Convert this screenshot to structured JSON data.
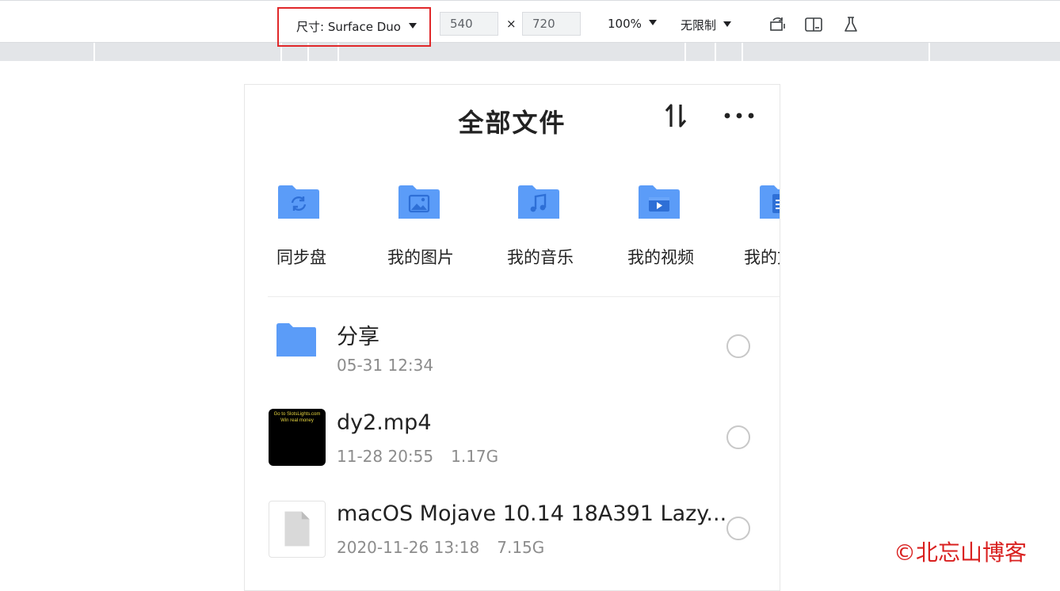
{
  "toolbar": {
    "dimensions_label": "尺寸: Surface Duo",
    "width_value": "540",
    "height_value": "720",
    "times_symbol": "×",
    "zoom_label": "100%",
    "throttle_label": "无限制"
  },
  "app": {
    "title": "全部文件",
    "categories": [
      {
        "label": "同步盘",
        "icon": "sync-folder-icon"
      },
      {
        "label": "我的图片",
        "icon": "image-folder-icon"
      },
      {
        "label": "我的音乐",
        "icon": "music-folder-icon"
      },
      {
        "label": "我的视频",
        "icon": "video-folder-icon"
      },
      {
        "label": "我的文",
        "icon": "document-folder-icon"
      }
    ],
    "files": [
      {
        "name": "分享",
        "date": "05-31 12:34",
        "size": "",
        "icon": "folder-icon"
      },
      {
        "name": "dy2.mp4",
        "date": "11-28 20:55",
        "size": "1.17G",
        "icon": "video-thumbnail",
        "thumb_text": [
          "Go to SlotsLights.com",
          "Win real money"
        ]
      },
      {
        "name": "macOS Mojave 10.14 18A391 Lazy...",
        "date": "2020-11-26 13:18",
        "size": "7.15G",
        "icon": "file-icon"
      }
    ]
  },
  "watermark": "©北忘山博客",
  "colors": {
    "folder": "#5b9cf8",
    "highlight": "#e0282a",
    "watermark": "#d9201f"
  }
}
